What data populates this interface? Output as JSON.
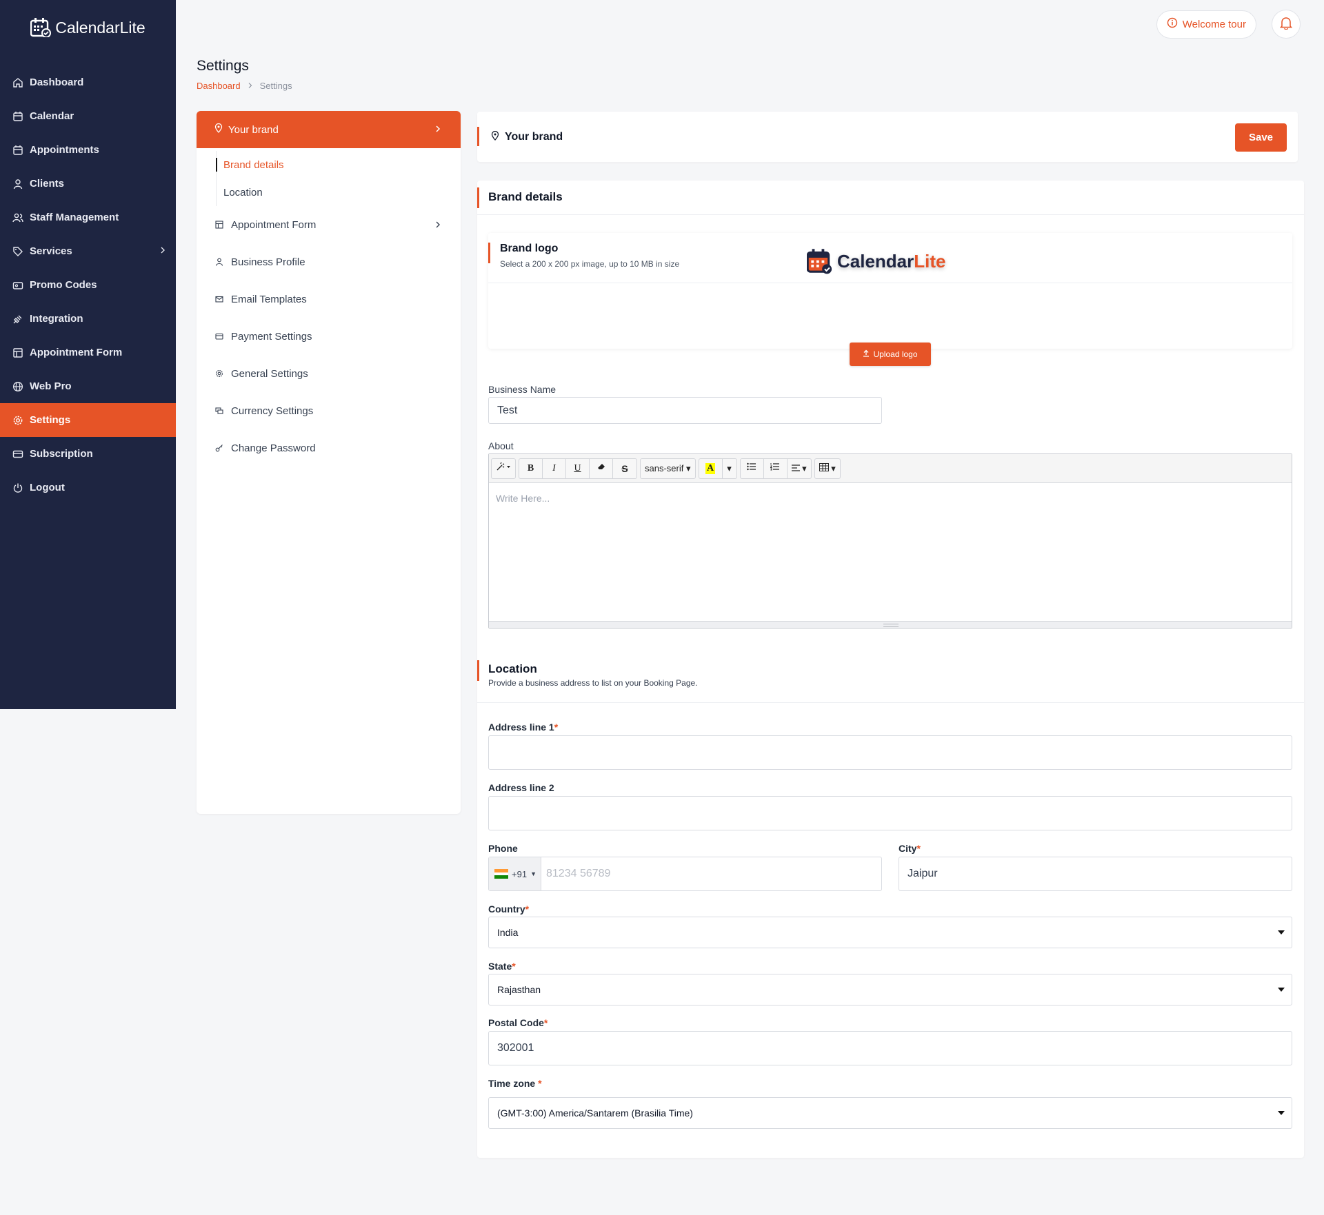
{
  "app": {
    "name_main": "Calendar",
    "name_accent": "Lite"
  },
  "sidebar": {
    "items": [
      {
        "label": "Dashboard",
        "icon": "home-icon"
      },
      {
        "label": "Calendar",
        "icon": "calendar-icon"
      },
      {
        "label": "Appointments",
        "icon": "calendar-check-icon"
      },
      {
        "label": "Clients",
        "icon": "user-icon"
      },
      {
        "label": "Staff Management",
        "icon": "users-icon"
      },
      {
        "label": "Services",
        "icon": "tag-icon"
      },
      {
        "label": "Promo Codes",
        "icon": "ticket-icon"
      },
      {
        "label": "Integration",
        "icon": "plug-icon"
      },
      {
        "label": "Appointment Form",
        "icon": "form-icon"
      },
      {
        "label": "Web Pro",
        "icon": "globe-icon"
      },
      {
        "label": "Settings",
        "icon": "gear-icon",
        "active": true
      },
      {
        "label": "Subscription",
        "icon": "card-icon"
      },
      {
        "label": "Logout",
        "icon": "power-icon"
      }
    ]
  },
  "header": {
    "welcome_tour": "Welcome tour"
  },
  "page": {
    "title": "Settings",
    "breadcrumb": [
      "Dashboard",
      "Settings"
    ]
  },
  "settings_menu": {
    "head": "Your brand",
    "children": [
      "Brand details",
      "Location"
    ],
    "items": [
      "Appointment Form",
      "Business Profile",
      "Email Templates",
      "Payment Settings",
      "General Settings",
      "Currency Settings",
      "Change Password"
    ]
  },
  "brand": {
    "header_title": "Your brand",
    "save_label": "Save",
    "details_title": "Brand details",
    "logo_title": "Brand logo",
    "logo_subtitle": "Select a 200 x 200 px image, up to 10 MB in size",
    "upload_label": "Upload logo",
    "business_name_label": "Business Name",
    "business_name_value": "Test",
    "about_label": "About",
    "editor": {
      "font_name": "sans-serif",
      "placeholder": "Write Here..."
    }
  },
  "location": {
    "title": "Location",
    "subtitle": "Provide a business address to list on your Booking Page.",
    "address1_label": "Address line 1",
    "address1_value": "",
    "address2_label": "Address line 2",
    "address2_value": "",
    "phone_label": "Phone",
    "phone_code": "+91",
    "phone_placeholder": "81234 56789",
    "city_label": "City",
    "city_value": "Jaipur",
    "country_label": "Country",
    "country_value": "India",
    "state_label": "State",
    "state_value": "Rajasthan",
    "postal_label": "Postal Code",
    "postal_value": "302001",
    "timezone_label": "Time zone",
    "timezone_value": "(GMT-3:00) America/Santarem (Brasilia Time)",
    "required_mark": "*"
  },
  "colors": {
    "accent": "#e65427",
    "sidebar": "#1e2541"
  }
}
